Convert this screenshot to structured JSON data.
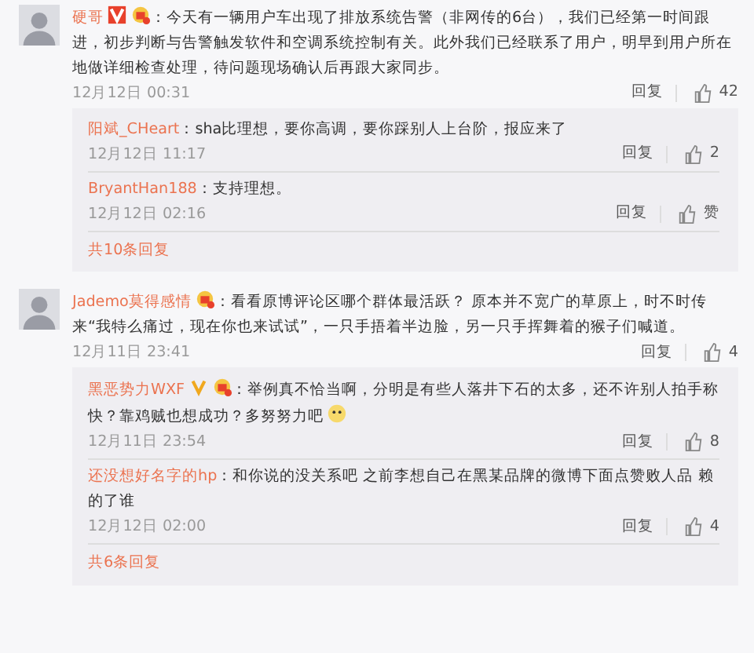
{
  "comments": [
    {
      "author": "硬哥",
      "badges": [
        {
          "kind": "verified",
          "color": "#e8412c"
        },
        {
          "kind": "medal"
        }
      ],
      "text": "：今天有一辆用户车出现了排放系统告警（非网传的6台），我们已经第一时间跟进，初步判断与告警触发软件和空调系统控制有关。此外我们已经联系了用户，明早到用户所在地做详细检查处理，待问题现场确认后再跟大家同步。",
      "time": "12月12日 00:31",
      "reply": "回复",
      "likes": "42",
      "replies": [
        {
          "author": "阳斌_CHeart",
          "text": "：sha比理想，要你高调，要你踩别人上台阶，报应来了",
          "time": "12月12日 11:17",
          "reply": "回复",
          "likes": "2"
        },
        {
          "author": "BryantHan188",
          "text": "：支持理想。",
          "time": "12月12日 02:16",
          "reply": "回复",
          "likes": "赞"
        }
      ],
      "more": "共10条回复"
    },
    {
      "author": "Jademo莫得感情",
      "badges": [
        {
          "kind": "medal"
        }
      ],
      "text": "：看看原博评论区哪个群体最活跃？ 原本并不宽广的草原上，时不时传来“我特么痛过，现在你也来试试”，一只手捂着半边脸，另一只手挥舞着的猴子们喊道。",
      "time": "12月11日 23:41",
      "reply": "回复",
      "likes": "4",
      "replies": [
        {
          "author": "黑恶势力WXF",
          "badges": [
            {
              "kind": "verified",
              "color": "#f0a81e"
            },
            {
              "kind": "medal"
            }
          ],
          "text": "：举例真不恰当啊，分明是有些人落井下石的太多，还不许别人拍手称快？靠鸡贼也想成功？多努努力吧",
          "emoji": true,
          "time": "12月11日 23:54",
          "reply": "回复",
          "likes": "8"
        },
        {
          "author": "还没想好名字的hp",
          "text": "：和你说的没关系吧 之前李想自己在黑某品牌的微博下面点赞败人品 赖的了谁",
          "time": "12月12日 02:00",
          "reply": "回复",
          "likes": "4"
        }
      ],
      "more": "共6条回复"
    }
  ]
}
